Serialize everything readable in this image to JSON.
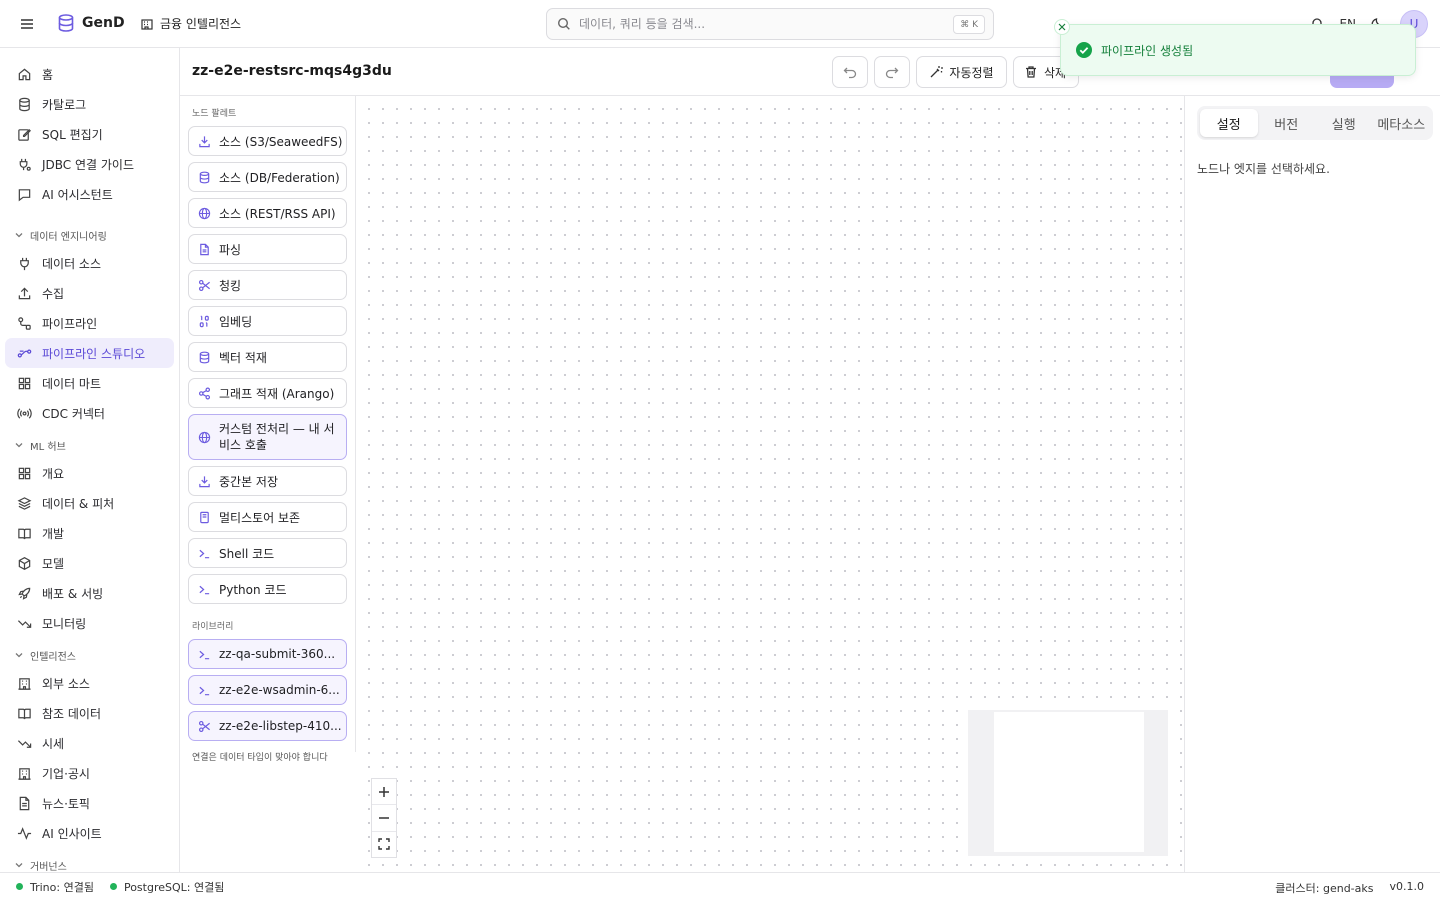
{
  "topbar": {
    "app_name": "GenD",
    "workspace": "금융 인텔리전스",
    "search_placeholder": "데이터, 쿼리 등을 검색...",
    "search_shortcut": "⌘ K",
    "language": "EN",
    "avatar_initial": "U"
  },
  "sidebar": {
    "top_items": [
      {
        "label": "홈",
        "icon": "home-icon"
      },
      {
        "label": "카탈로그",
        "icon": "database-icon"
      },
      {
        "label": "SQL 편집기",
        "icon": "edit-icon"
      },
      {
        "label": "JDBC 연결 가이드",
        "icon": "plug-icon"
      },
      {
        "label": "AI 어시스턴트",
        "icon": "chat-icon"
      }
    ],
    "sections": [
      {
        "title": "데이터 엔지니어링",
        "items": [
          {
            "label": "데이터 소스",
            "icon": "plug-icon"
          },
          {
            "label": "수집",
            "icon": "upload-icon"
          },
          {
            "label": "파이프라인",
            "icon": "route-icon"
          },
          {
            "label": "파이프라인 스튜디오",
            "icon": "workflow-icon",
            "active": true
          },
          {
            "label": "데이터 마트",
            "icon": "grid-icon"
          },
          {
            "label": "CDC 커넥터",
            "icon": "radio-icon"
          }
        ]
      },
      {
        "title": "ML 허브",
        "items": [
          {
            "label": "개요",
            "icon": "grid-icon"
          },
          {
            "label": "데이터 & 피처",
            "icon": "layers-icon"
          },
          {
            "label": "개발",
            "icon": "book-icon"
          },
          {
            "label": "모델",
            "icon": "box-icon"
          },
          {
            "label": "배포 & 서빙",
            "icon": "rocket-icon"
          },
          {
            "label": "모니터링",
            "icon": "trend-icon"
          }
        ]
      },
      {
        "title": "인텔리전스",
        "items": [
          {
            "label": "외부 소스",
            "icon": "building-icon"
          },
          {
            "label": "참조 데이터",
            "icon": "book-icon"
          },
          {
            "label": "시세",
            "icon": "trend-icon"
          },
          {
            "label": "기업·공시",
            "icon": "building-icon"
          },
          {
            "label": "뉴스·토픽",
            "icon": "file-icon"
          },
          {
            "label": "AI 인사이트",
            "icon": "pulse-icon"
          }
        ]
      },
      {
        "title": "거버넌스",
        "items": []
      }
    ]
  },
  "page": {
    "title": "zz-e2e-restsrc-mqs4g3du",
    "autolayout_label": "자동정렬",
    "delete_label": "삭제"
  },
  "palette": {
    "header": "노드 팔레트",
    "items": [
      {
        "label": "소스 (S3/SeaweedFS)",
        "icon": "download-icon"
      },
      {
        "label": "소스 (DB/Federation)",
        "icon": "database-icon"
      },
      {
        "label": "소스 (REST/RSS API)",
        "icon": "globe-icon"
      },
      {
        "label": "파싱",
        "icon": "file-icon"
      },
      {
        "label": "청킹",
        "icon": "scissors-icon"
      },
      {
        "label": "임베딩",
        "icon": "binary-icon"
      },
      {
        "label": "벡터 적재",
        "icon": "database-icon"
      },
      {
        "label": "그래프 적재 (Arango)",
        "icon": "share-icon"
      }
    ],
    "custom_item": {
      "label": "커스텀 전처리 — 내 서비스 호출",
      "icon": "globe-icon"
    },
    "items2": [
      {
        "label": "중간본 저장",
        "icon": "download-icon"
      },
      {
        "label": "멀티스토어 보존",
        "icon": "archive-icon"
      },
      {
        "label": "Shell 코드",
        "icon": "terminal-icon"
      },
      {
        "label": "Python 코드",
        "icon": "terminal-icon"
      }
    ],
    "library_header": "라이브러리",
    "library": [
      {
        "label": "zz-qa-submit-360...",
        "icon": "terminal-icon"
      },
      {
        "label": "zz-e2e-wsadmin-6...",
        "icon": "terminal-icon"
      },
      {
        "label": "zz-e2e-libstep-410...",
        "icon": "scissors-icon"
      }
    ],
    "footer": "연결은 데이터 타입이 맞아야 합니다"
  },
  "right_panel": {
    "tabs": [
      "설정",
      "버전",
      "실행",
      "메타소스"
    ],
    "active_tab": 0,
    "message": "노드나 엣지를 선택하세요."
  },
  "toast": {
    "message": "파이프라인 생성됨"
  },
  "statusbar": {
    "trino": "Trino: 연결됨",
    "postgres": "PostgreSQL: 연결됨",
    "cluster": "클러스터: gend-aks",
    "version": "v0.1.0"
  }
}
